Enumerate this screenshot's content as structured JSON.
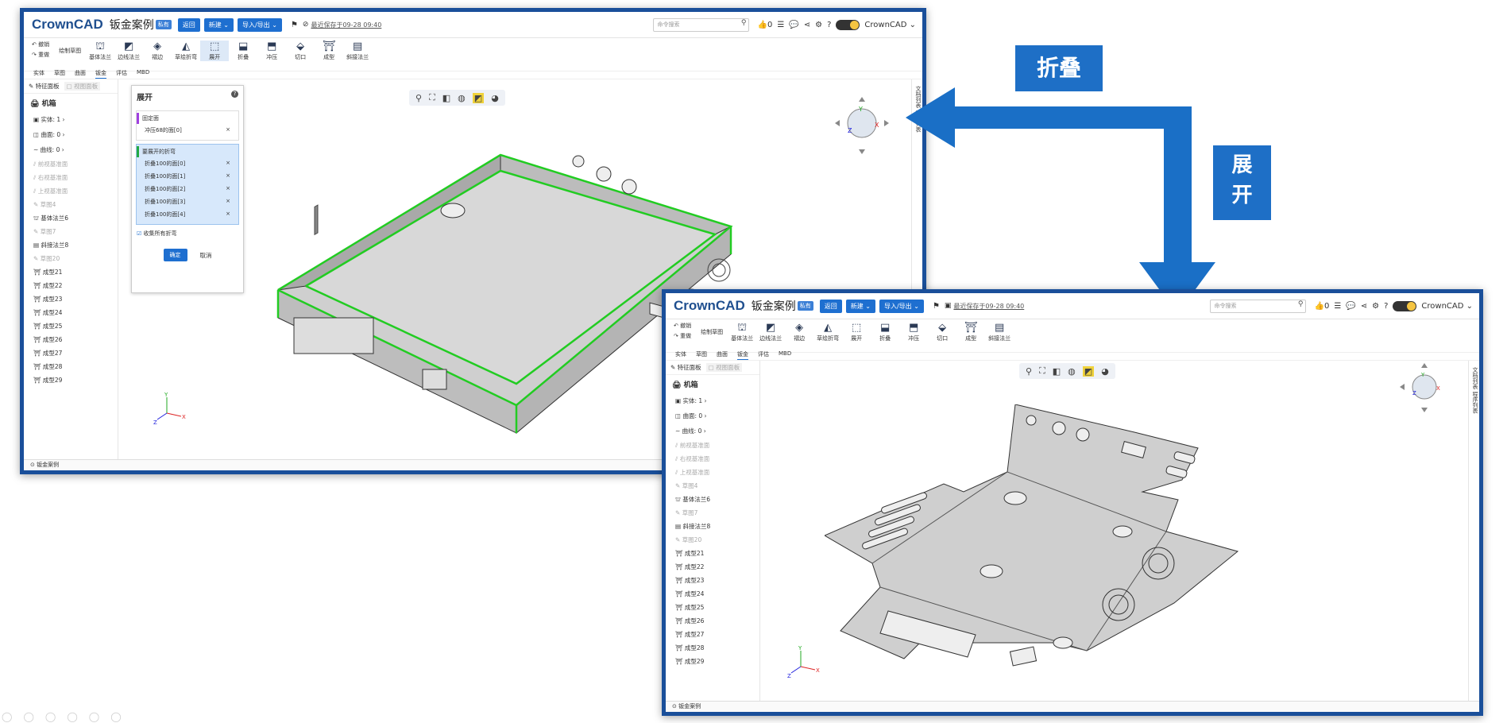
{
  "labels": {
    "fold": "折叠",
    "unfold_line1": "展",
    "unfold_line2": "开"
  },
  "app": {
    "logo_c": "C",
    "logo_rest": "rownCAD",
    "doc_title": "钣金案例",
    "private_badge": "私有",
    "back_btn": "返回",
    "new_btn": "新建 ⌄",
    "io_btn": "导入/导出 ⌄",
    "saved_text": "最近保存于09-28 09:40",
    "search_placeholder": "命令搜索",
    "like_count": "0",
    "user_name": "CrownCAD ⌄"
  },
  "ribbon": {
    "undo": "撤销",
    "redo": "重做",
    "sketch": "绘制草图",
    "tools": [
      "基体法兰",
      "边线法兰",
      "褶边",
      "草绘折弯",
      "展开",
      "折叠",
      "冲压",
      "切口",
      "成型",
      "斜接法兰"
    ],
    "tools_short": [
      "基体法兰",
      "边线法兰",
      "褶边",
      "草绘折弯",
      "展开",
      "折叠",
      "冲压",
      "切口",
      "成型",
      "斜接法兰"
    ]
  },
  "tabs": [
    "实体",
    "草图",
    "曲面",
    "钣金",
    "评估",
    "MBD"
  ],
  "sidebar": {
    "feature_panel": "特征面板",
    "view_panel": "视图面板",
    "root": "机箱",
    "solid": "实体: 1",
    "surface": "曲面: 0",
    "curve": "曲线: 0",
    "items": [
      {
        "label": "前视基准面",
        "dim": true
      },
      {
        "label": "右视基准面",
        "dim": true
      },
      {
        "label": "上视基准面",
        "dim": true
      },
      {
        "label": "草图4",
        "dim": true
      },
      {
        "label": "基体法兰6",
        "dim": false
      },
      {
        "label": "草图7",
        "dim": true
      },
      {
        "label": "斜接法兰8",
        "dim": false
      },
      {
        "label": "草图20",
        "dim": true
      },
      {
        "label": "成型21",
        "dim": false
      },
      {
        "label": "成型22",
        "dim": false
      },
      {
        "label": "成型23",
        "dim": false
      },
      {
        "label": "成型24",
        "dim": false
      },
      {
        "label": "成型25",
        "dim": false
      },
      {
        "label": "成型26",
        "dim": false
      },
      {
        "label": "成型27",
        "dim": false
      },
      {
        "label": "成型28",
        "dim": false
      },
      {
        "label": "成型29",
        "dim": false
      }
    ]
  },
  "status": "钣金案例",
  "right_panel": "文档列表  程序列表",
  "unfold_panel": {
    "title": "展开",
    "fixed_face_label": "固定面",
    "fixed_face_value": "冲压68的面[0]",
    "bends_label": "要展开的折弯",
    "bends": [
      "折叠100的面[0]",
      "折叠100的面[1]",
      "折叠100的面[2]",
      "折叠100的面[3]",
      "折叠100的面[4]"
    ],
    "collect_all": "收集所有折弯",
    "ok": "确定",
    "cancel": "取消"
  },
  "colors": {
    "accent": "#1e6fd0",
    "frame": "#1a4f9a",
    "label_bg": "#1e6fc6",
    "highlight_edge": "#22cc22"
  }
}
